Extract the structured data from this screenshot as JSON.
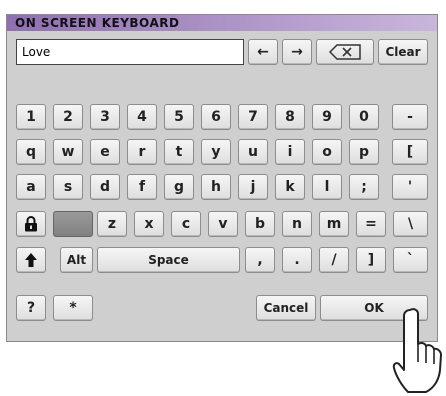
{
  "window": {
    "title": "ON SCREEN KEYBOARD"
  },
  "input": {
    "value": "Love"
  },
  "top_keys": {
    "left_arrow": "←",
    "right_arrow": "→",
    "clear": "Clear"
  },
  "rows": {
    "row1": [
      "1",
      "2",
      "3",
      "4",
      "5",
      "6",
      "7",
      "8",
      "9",
      "0",
      "-"
    ],
    "row2": [
      "q",
      "w",
      "e",
      "r",
      "t",
      "y",
      "u",
      "i",
      "o",
      "p",
      "["
    ],
    "row3": [
      "a",
      "s",
      "d",
      "f",
      "g",
      "h",
      "j",
      "k",
      "l",
      ";",
      "'"
    ],
    "row4": [
      "z",
      "x",
      "c",
      "v",
      "b",
      "n",
      "m",
      "=",
      "\\"
    ],
    "row5_right": [
      ",",
      ".",
      "/",
      "]",
      "`"
    ]
  },
  "special": {
    "alt": "Alt",
    "space": "Space",
    "question": "?",
    "asterisk": "*",
    "cancel": "Cancel",
    "ok": "OK"
  }
}
